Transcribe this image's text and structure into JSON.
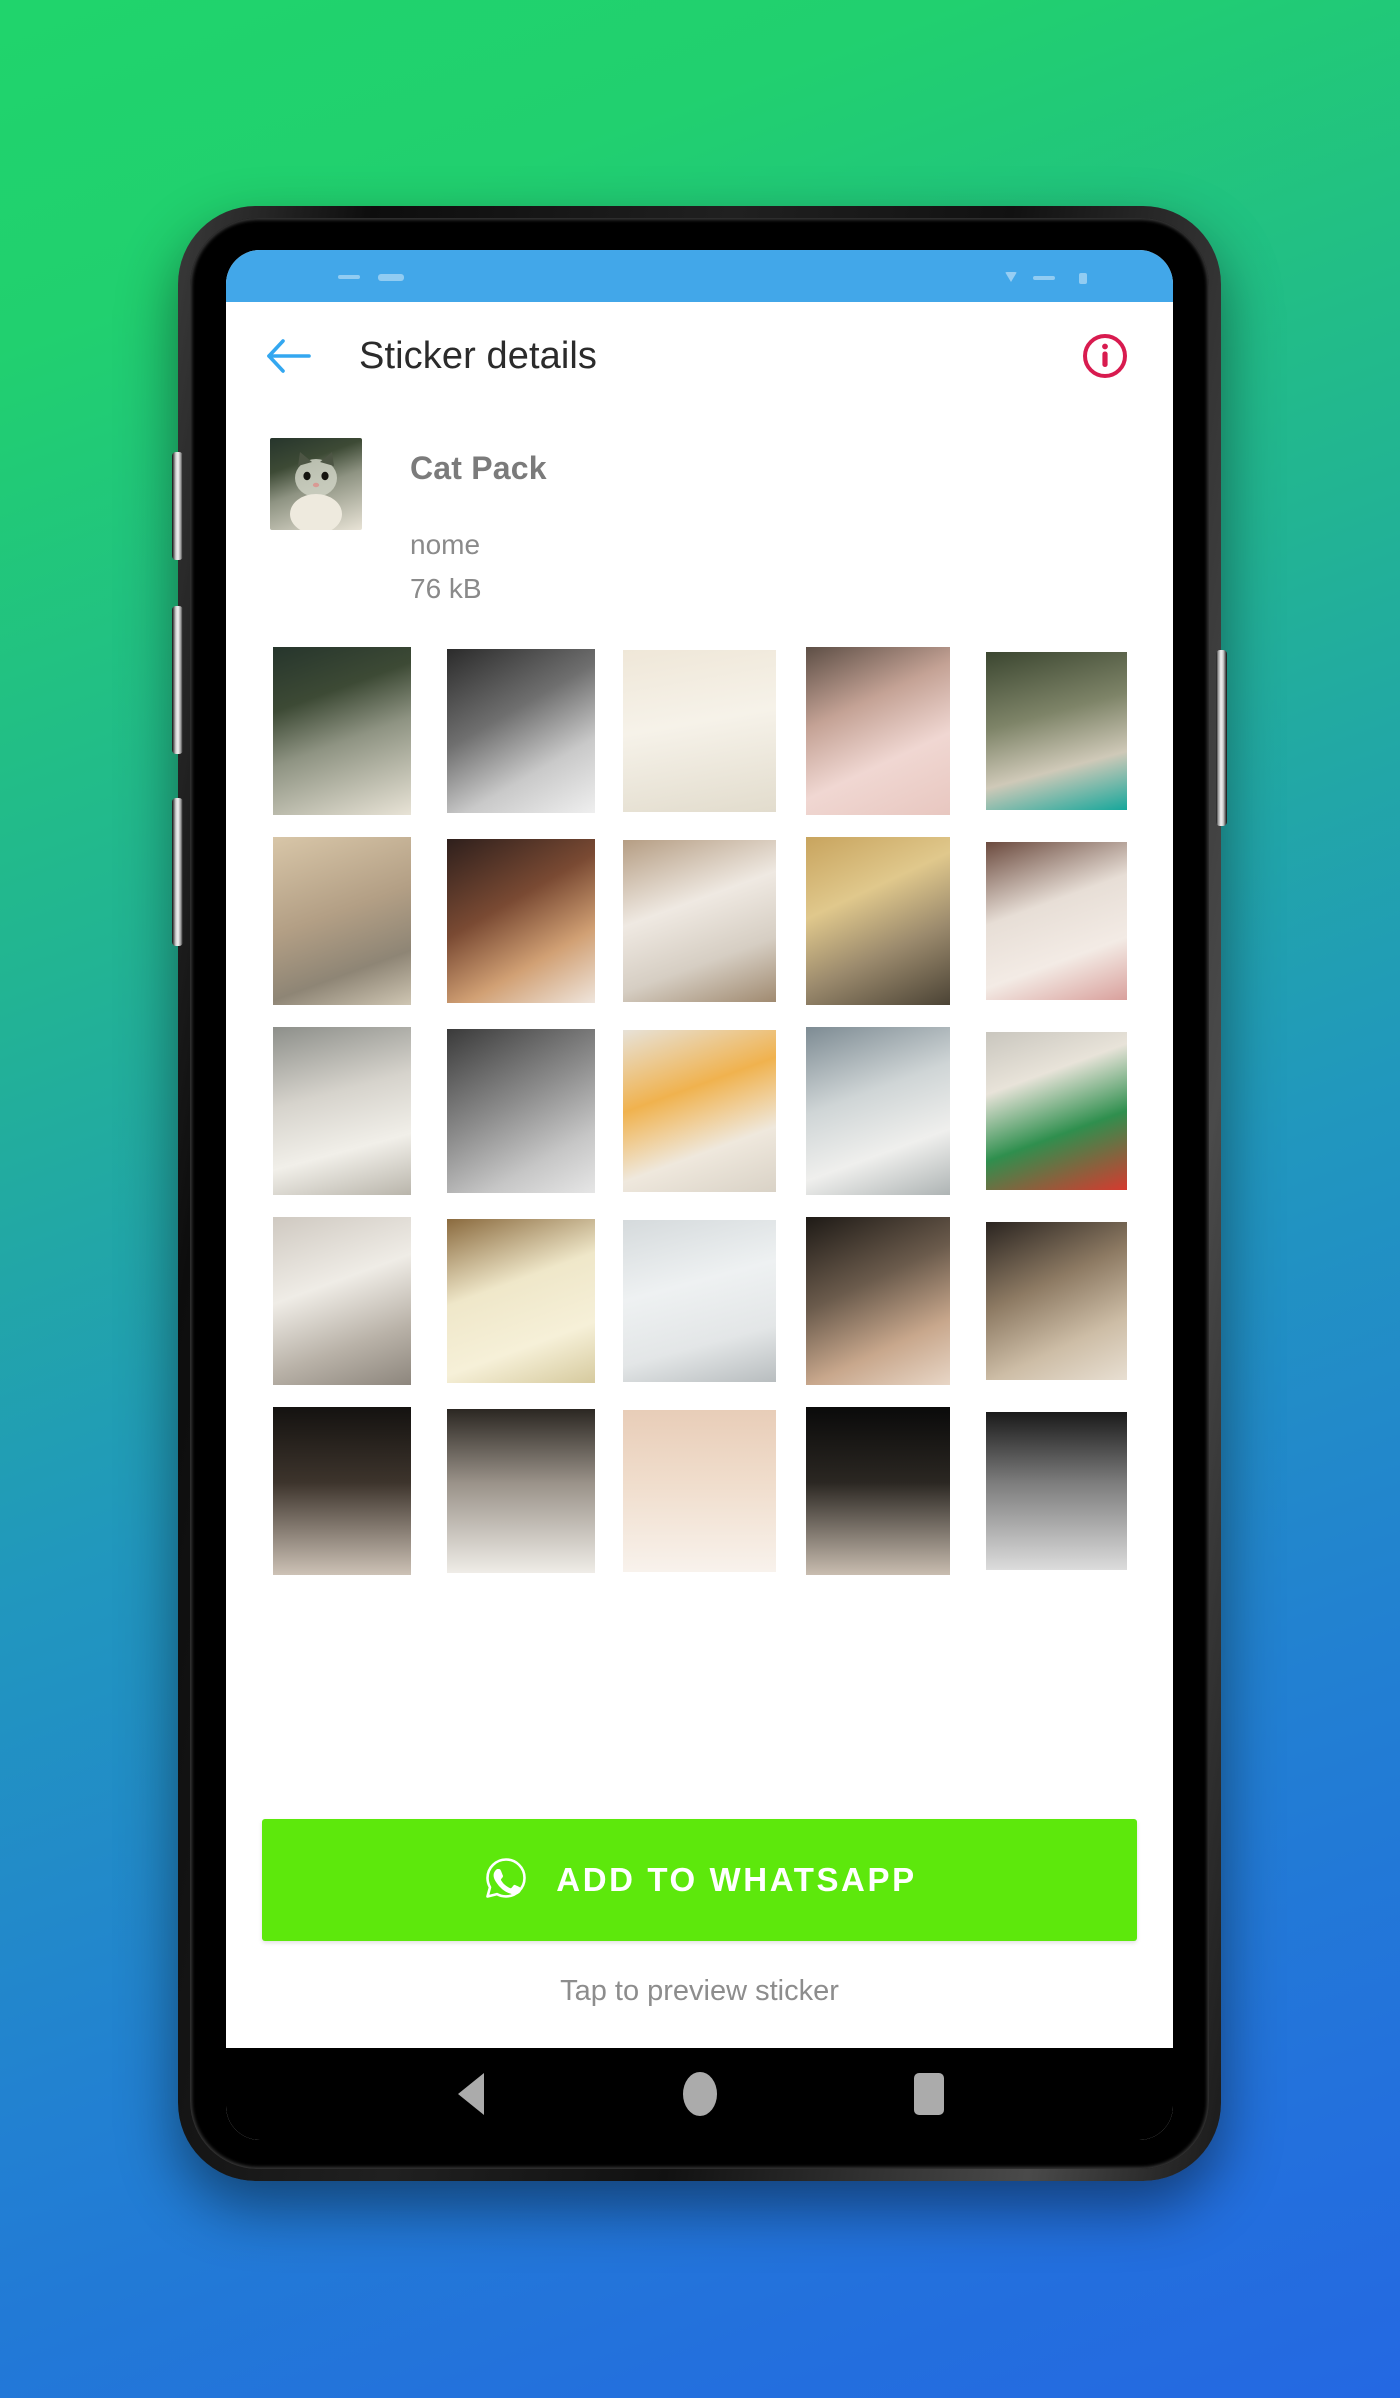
{
  "background": {
    "gradient_from": "#20D46C",
    "gradient_to": "#2468E2"
  },
  "device": {
    "frame_color": "#111111",
    "side_buttons": [
      "volume-up",
      "volume-down",
      "power",
      "assistant"
    ]
  },
  "status_bar": {
    "background": "#42A7E9"
  },
  "app_bar": {
    "back_label": "Back",
    "title": "Sticker details",
    "info_label": "Info",
    "back_icon_color": "#33A7F0",
    "info_icon_color": "#D81B4F",
    "title_color": "#2b2b2b"
  },
  "pack": {
    "name": "Cat Pack",
    "publisher": "nome",
    "size": "76 kB",
    "tray_icon_name": "cat-tray-icon"
  },
  "stickers": {
    "columns": 5,
    "items": [
      {
        "name": "grey-white-kitten-dark",
        "bg": "linear-gradient(160deg,#26352c 0%,#3d4a35 30%,#8e9382 55%,#e8e3d6 100%)"
      },
      {
        "name": "black-white-cat-gasp",
        "bg": "linear-gradient(150deg,#2b2b2b 0%,#6f6f6f 40%,#c9c9c9 70%,#efefef 100%)"
      },
      {
        "name": "white-cat-teary-eyes",
        "bg": "linear-gradient(170deg,#efe7d8 0%,#f6f2e9 45%,#e2dccd 100%)"
      },
      {
        "name": "crying-cat-paws-face",
        "bg": "linear-gradient(155deg,#5d4e45 0%,#c4a295 35%,#f0d7d2 65%,#e8c7c0 100%)"
      },
      {
        "name": "kitten-teal-background",
        "bg": "linear-gradient(165deg,#3b4630 0%,#7e8468 40%,#cfc9b8 70%,#16a79b 100%)"
      },
      {
        "name": "cat-wearing-hood",
        "bg": "linear-gradient(160deg,#d8c6a8 0%,#b39f85 45%,#8e8575 75%,#cfc6b3 100%)"
      },
      {
        "name": "cat-with-microphone",
        "bg": "linear-gradient(150deg,#2e1f1c 0%,#7a4a33 40%,#d1a074 70%,#efe5dc 100%)"
      },
      {
        "name": "white-cat-thumbs-up",
        "bg": "linear-gradient(160deg,#b59d83 0%,#efe9e2 40%,#d6cec3 70%,#a08a70 100%)"
      },
      {
        "name": "tabby-cat-on-blanket",
        "bg": "linear-gradient(155deg,#c8a45e 0%,#e0c88c 35%,#9b8a6d 65%,#4b4335 100%)"
      },
      {
        "name": "cat-licking-tongue-out",
        "bg": "linear-gradient(160deg,#6b4a3e 0%,#e7ded6 40%,#f3ebe5 70%,#d9a09c 100%)"
      },
      {
        "name": "grey-white-cat-big-eyes",
        "bg": "linear-gradient(165deg,#8d8f8a 0%,#d6d3cc 40%,#f1efe9 70%,#b9b5ab 100%)"
      },
      {
        "name": "grey-cat-mouth-open",
        "bg": "linear-gradient(150deg,#3a3a3a 0%,#8c8c8c 45%,#c6c6c6 75%,#e6e6e6 100%)"
      },
      {
        "name": "cat-hugging-orange-toy",
        "bg": "linear-gradient(160deg,#e7e2d8 0%,#f0b24e 38%,#efe8dd 70%,#d9d2c6 100%)"
      },
      {
        "name": "white-cat-staring",
        "bg": "linear-gradient(160deg,#7d8b93 0%,#cfd5d6 40%,#efefed 70%,#aeb4b4 100%)"
      },
      {
        "name": "kitten-in-pringles-can",
        "bg": "linear-gradient(160deg,#c9c6be 0%,#e8e3d9 30%,#2f8f4e 62%,#d63a2f 100%)"
      },
      {
        "name": "cat-wearing-cap",
        "bg": "linear-gradient(160deg,#cfc9c1 0%,#efece6 40%,#b9b2a8 72%,#8d867d 100%)"
      },
      {
        "name": "cream-cat-sitting",
        "bg": "linear-gradient(160deg,#8a6a3e 0%,#efe7c9 40%,#f6f0d8 72%,#d6ca9e 100%)"
      },
      {
        "name": "white-cat-sad-eyes",
        "bg": "linear-gradient(165deg,#d5dadc 0%,#eef1f2 40%,#e3e6e7 72%,#b8bdbf 100%)"
      },
      {
        "name": "cat-held-in-hands",
        "bg": "linear-gradient(155deg,#1e1a16 0%,#6b5b4c 40%,#c8a78c 72%,#e8d6c6 100%)"
      },
      {
        "name": "two-kittens-cuddling",
        "bg": "linear-gradient(155deg,#2a2420 0%,#8d7a63 40%,#cdbda6 72%,#e8dfd2 100%)"
      },
      {
        "name": "cat-row5-partial-1",
        "bg": "linear-gradient(180deg,#141210 0%,#3d342c 45%,#cdc2b6 100%)"
      },
      {
        "name": "cat-row5-partial-2",
        "bg": "linear-gradient(180deg,#2b2722 0%,#9a9289 45%,#efece7 100%)"
      },
      {
        "name": "cat-row5-partial-3",
        "bg": "linear-gradient(180deg,#e8cdb8 0%,#f0ddcc 45%,#f8f2ec 100%)"
      },
      {
        "name": "cat-row5-partial-4",
        "bg": "linear-gradient(180deg,#0a0a0a 0%,#2b2722 45%,#c9bdb0 100%)"
      },
      {
        "name": "cat-row5-partial-5",
        "bg": "linear-gradient(180deg,#1a1a1a 0%,#7d7d7d 45%,#dcdcdc 100%)"
      }
    ]
  },
  "cta": {
    "label": "ADD TO WHATSAPP",
    "icon_name": "whatsapp-icon",
    "background": "#5DE80C",
    "text_color": "#FFFFFF"
  },
  "hint": {
    "text": "Tap to preview sticker",
    "color": "#8d8d8d"
  },
  "nav_bar": {
    "background": "#000000",
    "icon_color": "#ABABAB",
    "buttons": [
      "back",
      "home",
      "recents"
    ]
  }
}
